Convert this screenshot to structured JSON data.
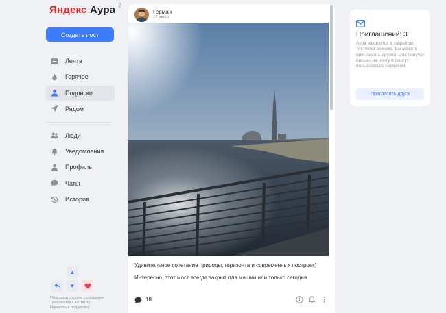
{
  "app": {
    "logo_ya": "Яндекс",
    "logo_brand": "Аура",
    "logo_beta": "β"
  },
  "sidebar": {
    "create_post": "Создать пост",
    "nav_primary": [
      {
        "label": "Лента",
        "icon": "feed-icon",
        "active": false
      },
      {
        "label": "Горячее",
        "icon": "flame-icon",
        "active": false
      },
      {
        "label": "Подписки",
        "icon": "person-icon",
        "active": true
      },
      {
        "label": "Рядом",
        "icon": "location-arrow-icon",
        "active": false
      }
    ],
    "nav_secondary": [
      {
        "label": "Люди",
        "icon": "people-icon"
      },
      {
        "label": "Уведомления",
        "icon": "bell-icon"
      },
      {
        "label": "Профиль",
        "icon": "profile-icon"
      },
      {
        "label": "Чаты",
        "icon": "chat-icon"
      },
      {
        "label": "История",
        "icon": "history-icon"
      }
    ],
    "footer_links": [
      "Пользовательское соглашение",
      "Требования к контенту",
      "Написать в поддержку"
    ]
  },
  "post": {
    "author": "Герман",
    "date": "27 июля",
    "text_1": "Удивительное сочетание природы, горизонта и современных построек)",
    "text_2": "Интересно, этот мост всегда закрыт для машин или только сегодня",
    "comments": "18"
  },
  "invites": {
    "title": "Приглашений: 3",
    "description": "Аура находится в закрытом тестовом режиме. Вы можете приглашать друзей. Они получат письмо на почту и смогут пользоваться сервисом",
    "button": "Пригласить друга"
  },
  "colors": {
    "accent": "#3d7bff",
    "logo_red": "#e32222",
    "heart": "#e04257"
  }
}
